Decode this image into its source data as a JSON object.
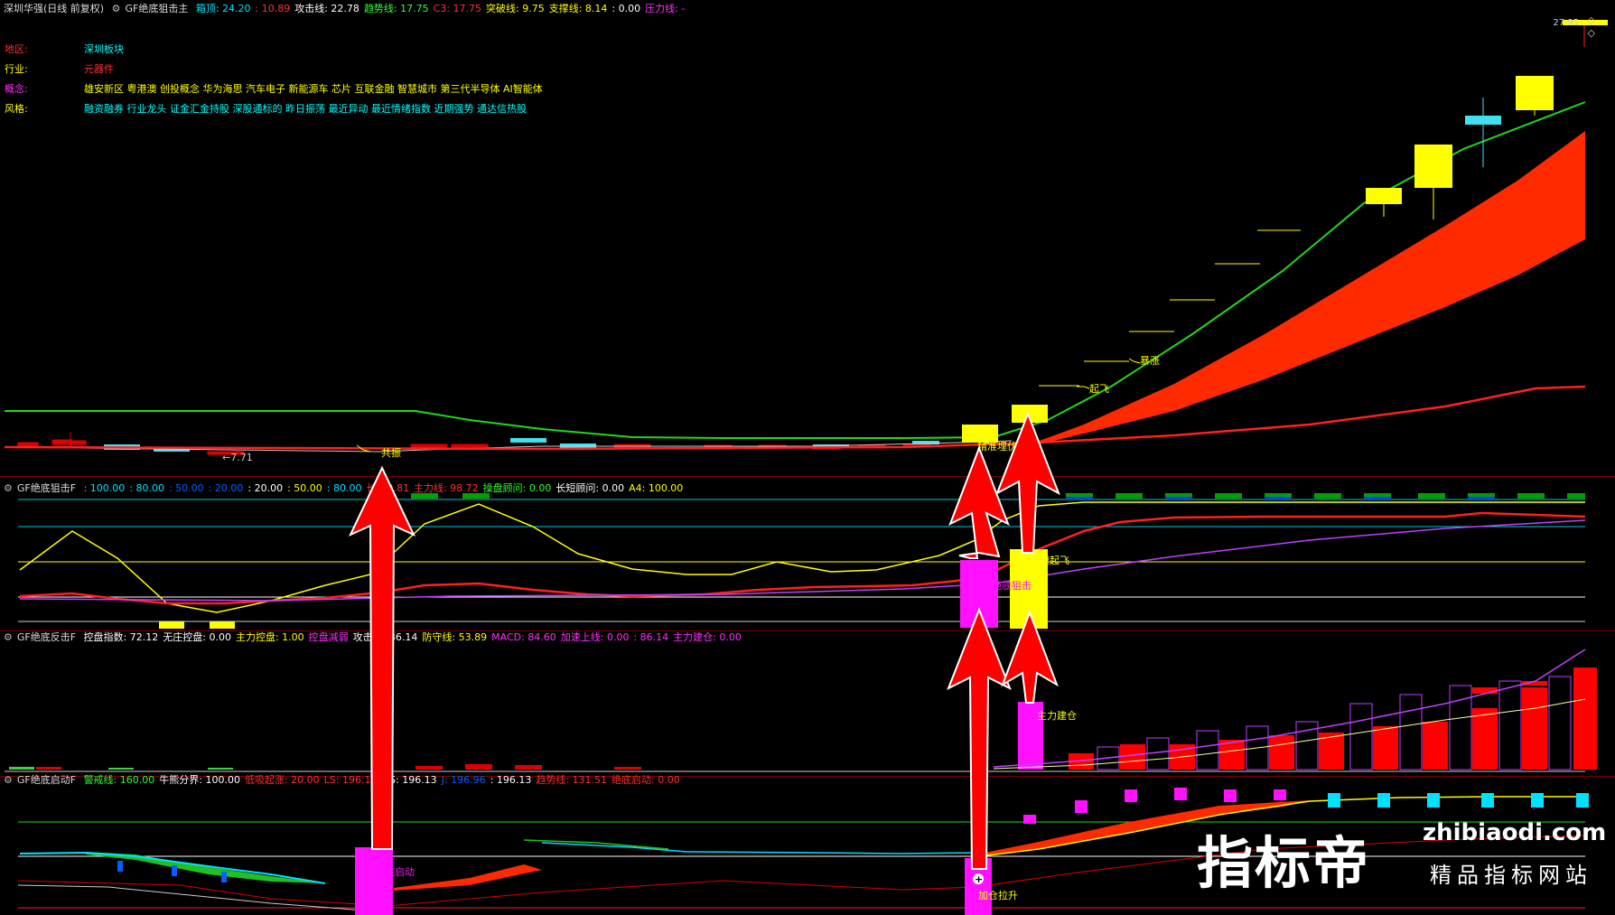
{
  "main": {
    "title": "深圳华强(日线 前复权)",
    "indicator": "GF绝底狙击主",
    "params": [
      {
        "t": "箱顶: 24.20",
        "c": "#00e0ff"
      },
      {
        "t": ": 10.89",
        "c": "#ff3030"
      },
      {
        "t": "攻击线: 22.78",
        "c": "#ffffff"
      },
      {
        "t": "趋势线: 17.75",
        "c": "#30ff30"
      },
      {
        "t": "C3: 17.75",
        "c": "#ff3030"
      },
      {
        "t": "突破线: 9.75",
        "c": "#ffff00"
      },
      {
        "t": "支撑线: 8.14",
        "c": "#ffff00"
      },
      {
        "t": ": 0.00",
        "c": "#ffffff"
      },
      {
        "t": "压力线: -",
        "c": "#ff30ff"
      }
    ],
    "info": [
      {
        "k": "地区:",
        "kc": "#ff3030",
        "v": "深圳板块",
        "vc": "#00ffff"
      },
      {
        "k": "行业:",
        "kc": "#ffff00",
        "v": "元器件",
        "vc": "#ff3030"
      },
      {
        "k": "概念:",
        "kc": "#ff30ff",
        "v": "雄安新区 粤港澳 创投概念 华为海思 汽车电子 新能源车 芯片 互联金融 智慧城市 第三代半导体 AI智能体",
        "vc": "#ffff00"
      },
      {
        "k": "风格:",
        "kc": "#ffff00",
        "v": "融资融券 行业龙头 证金汇金持股 深股通标的 昨日振荡 最近异动 最近情绪指数 近期强势 通达信热股",
        "vc": "#00ffff"
      }
    ],
    "price_label": "27.95",
    "low_label": "←7.71",
    "tags": {
      "gongzhen": "共振",
      "qifei": "起飞",
      "baozhang": "暴涨",
      "jingzhun": "精准埋伏"
    }
  },
  "p2": {
    "indicator": "GF绝底狙击F",
    "params": [
      {
        "t": ": 100.00",
        "c": "#00e0ff"
      },
      {
        "t": ": 80.00",
        "c": "#00e0ff"
      },
      {
        "t": ": 50.00",
        "c": "#0060ff"
      },
      {
        "t": ": 20.00",
        "c": "#0060ff"
      },
      {
        "t": ": 20.00",
        "c": "#ffffff"
      },
      {
        "t": ": 50.00",
        "c": "#ffff00"
      },
      {
        "t": ": 80.00",
        "c": "#00e0ff"
      },
      {
        "t": "长",
        "c": "#ff3030"
      },
      {
        "t": "80.81",
        "c": "#ff3030"
      },
      {
        "t": "主力线: 98.72",
        "c": "#ff3030"
      },
      {
        "t": "操盘顾问: 0.00",
        "c": "#30ff30"
      },
      {
        "t": "长短顾问: 0.00",
        "c": "#ffffff"
      },
      {
        "t": "A4: 100.00",
        "c": "#ffff00"
      }
    ],
    "tags": {
      "juji": "绝底狙击",
      "qifei": "加速起飞"
    }
  },
  "p3": {
    "indicator": "GF绝底反击F",
    "params": [
      {
        "t": "控盘指数: 72.12",
        "c": "#ffffff"
      },
      {
        "t": "无庄控盘: 0.00",
        "c": "#ffffff"
      },
      {
        "t": "主力控盘: 1.00",
        "c": "#ffff00"
      },
      {
        "t": "控盘减弱",
        "c": "#ff30ff"
      },
      {
        "t": "攻击线: 86.14",
        "c": "#ffffff"
      },
      {
        "t": "防守线: 53.89",
        "c": "#ffff00"
      },
      {
        "t": "MACD: 84.60",
        "c": "#ff30ff"
      },
      {
        "t": "加速上线: 0.00",
        "c": "#ff30ff"
      },
      {
        "t": ": 86.14",
        "c": "#ff30ff"
      },
      {
        "t": "主力建仓: 0.00",
        "c": "#ff30ff"
      }
    ],
    "tags": {
      "jiancang": "主力建仓"
    }
  },
  "p4": {
    "indicator": "GF绝底启动F",
    "params": [
      {
        "t": "警戒线: 160.00",
        "c": "#30ff30"
      },
      {
        "t": "牛熊分界: 100.00",
        "c": "#ffffff"
      },
      {
        "t": "低吸起涨: 20.00",
        "c": "#ff3030"
      },
      {
        "t": "LS: 196.13",
        "c": "#ff3030"
      },
      {
        "t": "GS: 196.13",
        "c": "#ffffff"
      },
      {
        "t": "J: 196.96",
        "c": "#0060ff"
      },
      {
        "t": ": 196.13",
        "c": "#ffffff"
      },
      {
        "t": "趋势线: 131.51",
        "c": "#ff3030"
      },
      {
        "t": "绝底启动: 0.00",
        "c": "#ff3030"
      }
    ],
    "tags": {
      "qidong": "绝底启动",
      "lasheng": "加仓拉升"
    }
  },
  "watermark": {
    "big": "指标帝",
    "url": "zhibiaodi.com",
    "sub": "精品指标网站"
  }
}
